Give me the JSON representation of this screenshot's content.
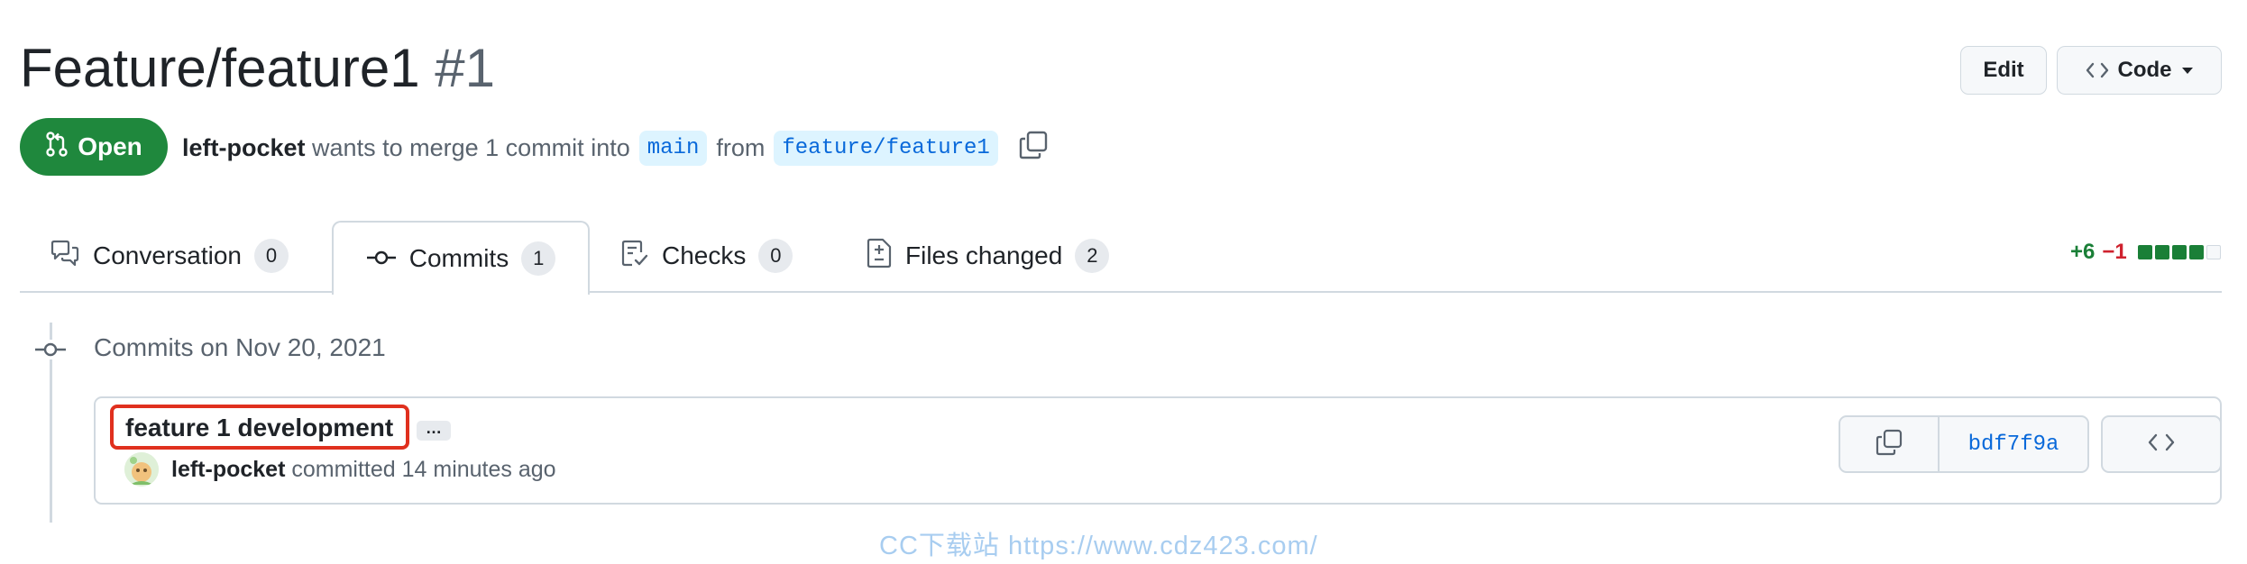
{
  "header": {
    "title": "Feature/feature1",
    "number": "#1",
    "edit_label": "Edit",
    "code_label": "Code"
  },
  "state": {
    "label": "Open",
    "author": "left-pocket",
    "text_wants": "wants to merge",
    "commit_count": "1 commit",
    "text_into": "into",
    "base_branch": "main",
    "text_from": "from",
    "head_branch": "feature/feature1"
  },
  "tabs": [
    {
      "label": "Conversation",
      "count": "0",
      "icon": "comment-discussion-icon"
    },
    {
      "label": "Commits",
      "count": "1",
      "icon": "git-commit-icon"
    },
    {
      "label": "Checks",
      "count": "0",
      "icon": "checklist-icon"
    },
    {
      "label": "Files changed",
      "count": "2",
      "icon": "file-diff-icon"
    }
  ],
  "diffstat": {
    "additions": "+6",
    "deletions": "−1"
  },
  "commits": {
    "date_heading": "Commits on Nov 20, 2021",
    "items": [
      {
        "title": "feature 1 development",
        "author": "left-pocket",
        "time": "committed 14 minutes ago",
        "sha": "bdf7f9a"
      }
    ]
  },
  "watermark": "CC下载站 https://www.cdz423.com/",
  "colors": {
    "open_green": "#1f883d",
    "link_blue": "#0969da",
    "branch_bg": "#ddf4ff",
    "addition": "#1a7f37",
    "deletion": "#cf222e",
    "highlight_red": "#e0301e"
  }
}
